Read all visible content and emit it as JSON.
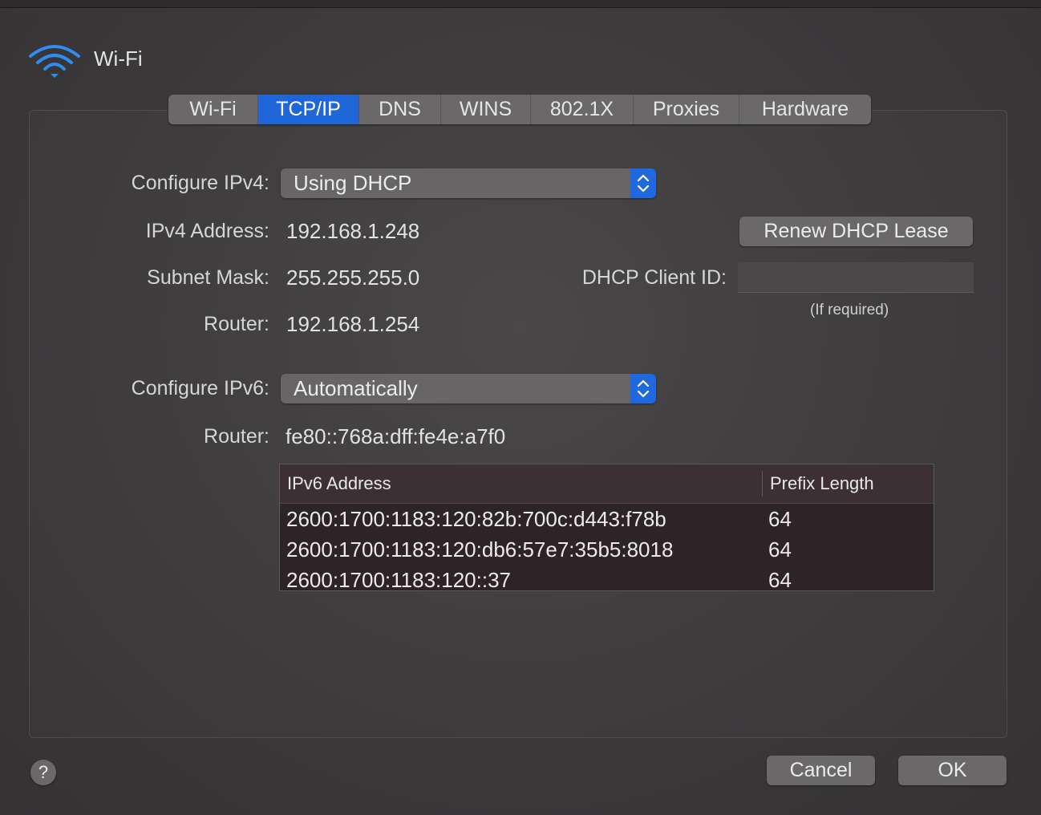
{
  "window": {
    "title": "Wi-Fi",
    "icon": "wifi-icon"
  },
  "tabs": [
    {
      "label": "Wi-Fi",
      "active": false
    },
    {
      "label": "TCP/IP",
      "active": true
    },
    {
      "label": "DNS",
      "active": false
    },
    {
      "label": "WINS",
      "active": false
    },
    {
      "label": "802.1X",
      "active": false
    },
    {
      "label": "Proxies",
      "active": false
    },
    {
      "label": "Hardware",
      "active": false
    }
  ],
  "ipv4": {
    "configure_label": "Configure IPv4:",
    "configure_value": "Using DHCP",
    "address_label": "IPv4 Address:",
    "address_value": "192.168.1.248",
    "subnet_label": "Subnet Mask:",
    "subnet_value": "255.255.255.0",
    "router_label": "Router:",
    "router_value": "192.168.1.254",
    "renew_button": "Renew DHCP Lease",
    "client_id_label": "DHCP Client ID:",
    "client_id_value": "",
    "client_id_hint": "(If required)"
  },
  "ipv6": {
    "configure_label": "Configure IPv6:",
    "configure_value": "Automatically",
    "router_label": "Router:",
    "router_value": "fe80::768a:dff:fe4e:a7f0",
    "table": {
      "columns": [
        "IPv6 Address",
        "Prefix Length"
      ],
      "rows": [
        [
          "2600:1700:1183:120:82b:700c:d443:f78b",
          "64"
        ],
        [
          "2600:1700:1183:120:db6:57e7:35b5:8018",
          "64"
        ],
        [
          "2600:1700:1183:120::37",
          "64"
        ]
      ]
    }
  },
  "footer": {
    "help": "?",
    "cancel": "Cancel",
    "ok": "OK"
  },
  "colors": {
    "accent": "#1f66d9",
    "background": "#3a3839",
    "button": "#6a6869"
  }
}
